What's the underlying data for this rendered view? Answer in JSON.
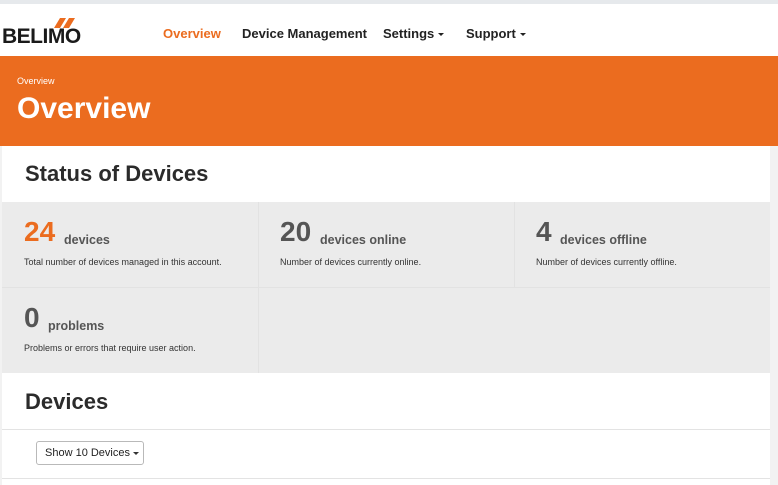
{
  "brand": {
    "name": "BELIMO",
    "accent": "#eb6c1f"
  },
  "nav": {
    "items": [
      {
        "label": "Overview",
        "active": true,
        "dropdown": false
      },
      {
        "label": "Device Management",
        "active": false,
        "dropdown": false
      },
      {
        "label": "Settings",
        "active": false,
        "dropdown": true
      },
      {
        "label": "Support",
        "active": false,
        "dropdown": true
      }
    ]
  },
  "banner": {
    "breadcrumb": "Overview",
    "title": "Overview"
  },
  "status": {
    "heading": "Status of Devices",
    "cards": [
      {
        "value": "24",
        "unit": "devices",
        "description": "Total number of devices managed in this account."
      },
      {
        "value": "20",
        "unit": "devices online",
        "description": "Number of devices currently online."
      },
      {
        "value": "4",
        "unit": "devices offline",
        "description": "Number of devices currently offline."
      },
      {
        "value": "0",
        "unit": "problems",
        "description": "Problems or errors that require user action."
      }
    ]
  },
  "devices": {
    "heading": "Devices",
    "show_button": "Show 10 Devices"
  }
}
